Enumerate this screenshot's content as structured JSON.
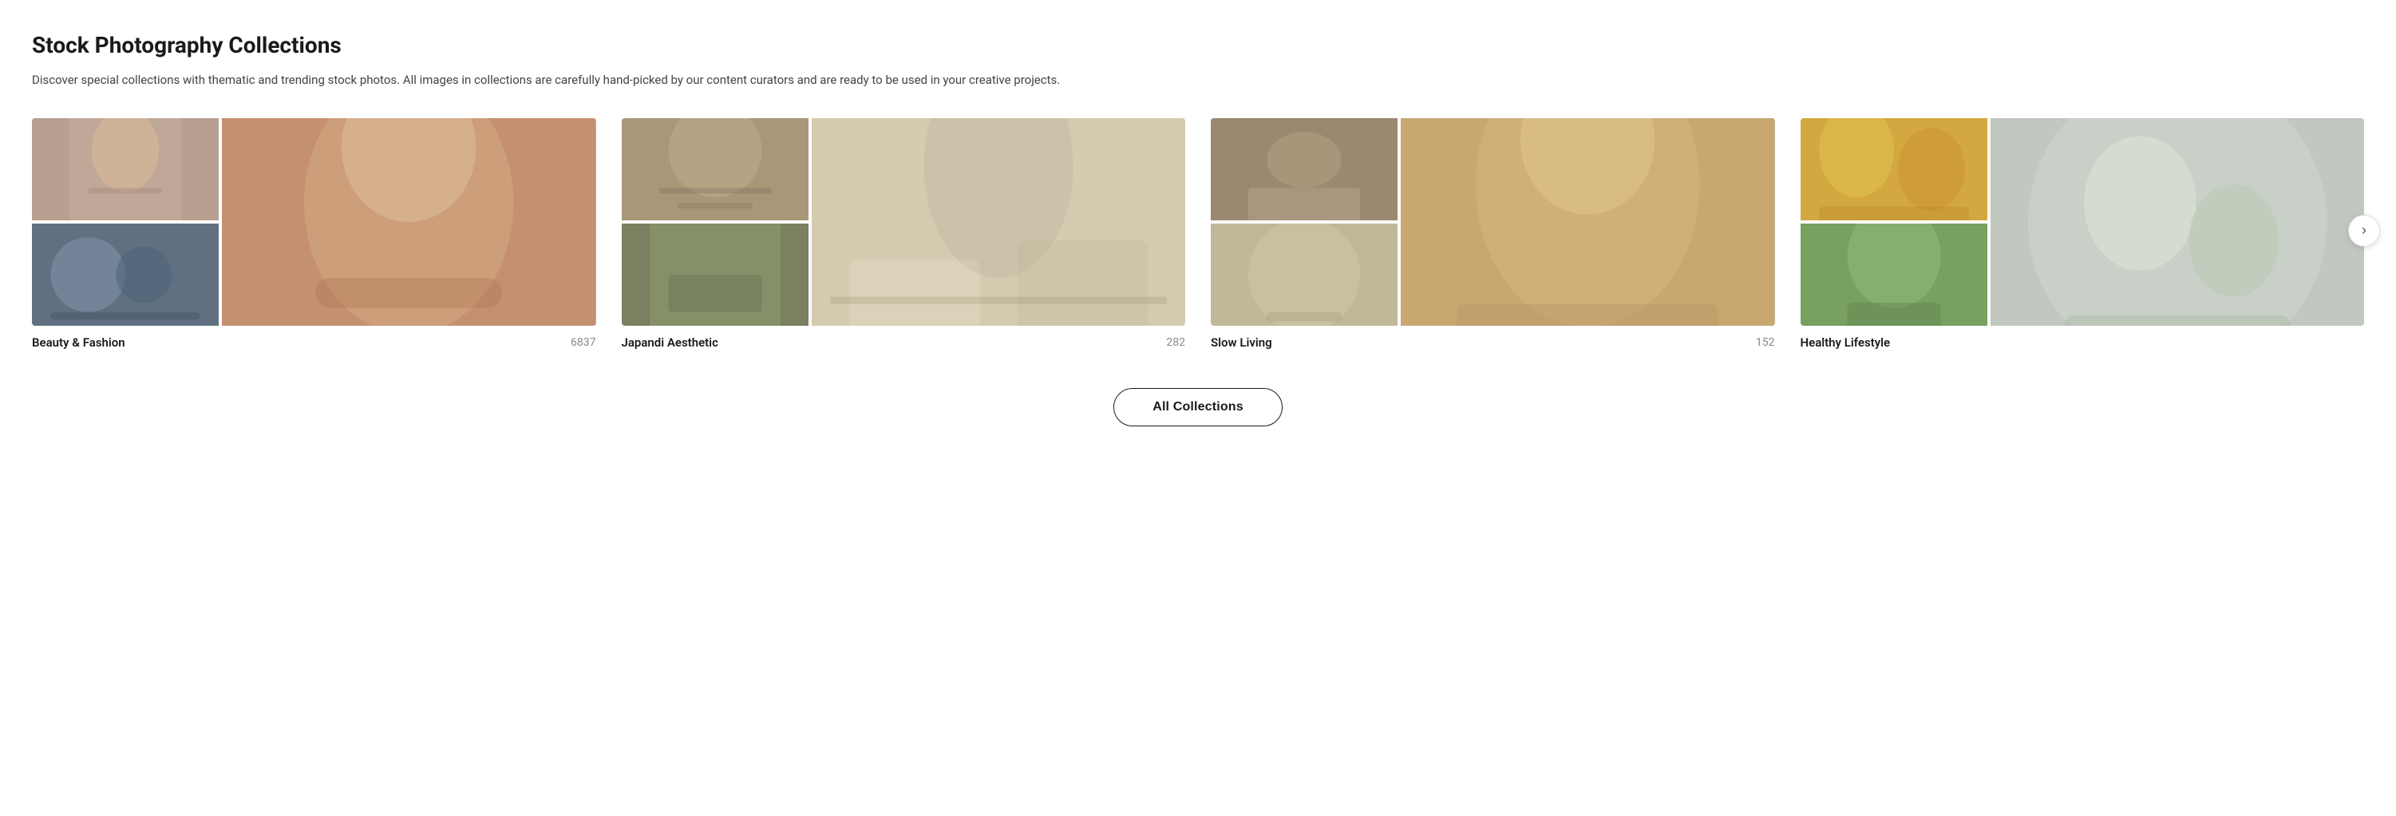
{
  "page": {
    "title": "Stock Photography Collections",
    "description": "Discover special collections with thematic and trending stock photos. All images in collections are carefully hand-picked by our content curators and are ready to be used in your creative projects."
  },
  "collections": [
    {
      "id": "beauty-fashion",
      "name": "Beauty & Fashion",
      "count": "6837",
      "images": {
        "small1_color": "#b5a090",
        "small1_color2": "#c8a878",
        "small2_color": "#6a7880",
        "small2_color2": "#8090a0",
        "large_color": "#c49070",
        "large_color2": "#d4a880"
      }
    },
    {
      "id": "japandi-aesthetic",
      "name": "Japandi Aesthetic",
      "count": "282",
      "images": {
        "small1_color": "#a89878",
        "small2_color": "#607060",
        "large_color": "#d4cbb0"
      }
    },
    {
      "id": "slow-living",
      "name": "Slow Living",
      "count": "152",
      "images": {
        "small1_color": "#9a8870",
        "small2_color": "#c0b898",
        "large_color": "#c0a878"
      }
    },
    {
      "id": "healthy-lifestyle",
      "name": "Healthy Lifestyle",
      "count": "",
      "images": {
        "small1_color": "#d4a840",
        "small2_color": "#78a060",
        "large_color": "#c8d0c8"
      }
    }
  ],
  "buttons": {
    "all_collections": "All Collections",
    "next": "›"
  }
}
